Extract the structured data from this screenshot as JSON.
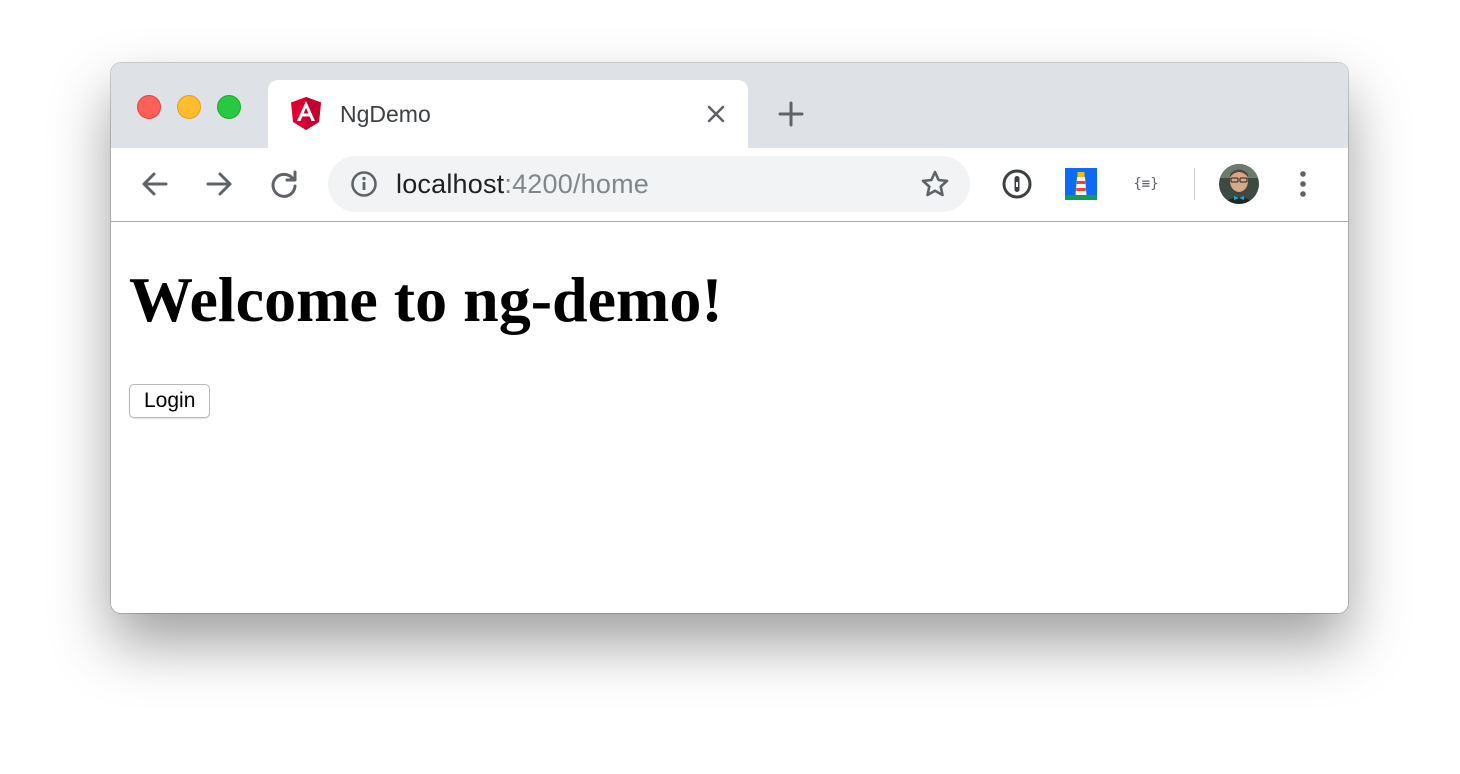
{
  "browser": {
    "tab": {
      "title": "NgDemo",
      "favicon": "angular-icon"
    },
    "address_bar": {
      "host": "localhost",
      "rest": ":4200/home"
    },
    "extensions": [
      "1password-icon",
      "lighthouse-icon",
      "json-formatter-icon"
    ],
    "colors": {
      "tabstrip": "#dee1e6",
      "omnibox": "#f1f3f4",
      "angular_red": "#dd0031",
      "close": "#fe5f57",
      "minimize": "#febc2e",
      "maximize": "#28c840"
    }
  },
  "page": {
    "heading": "Welcome to ng-demo!",
    "login_label": "Login"
  }
}
